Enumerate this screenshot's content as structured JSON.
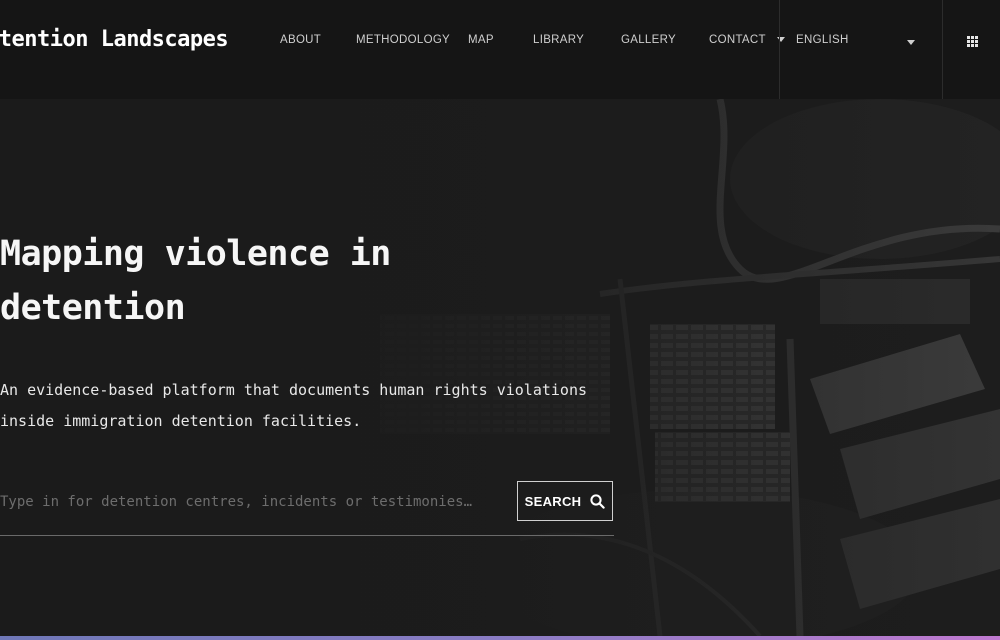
{
  "header": {
    "brand": "etention Landscapes",
    "nav": [
      {
        "label": "ABOUT"
      },
      {
        "label": "METHODOLOGY"
      },
      {
        "label": "MAP"
      },
      {
        "label": "LIBRARY"
      },
      {
        "label": "GALLERY"
      },
      {
        "label": "CONTACT"
      }
    ],
    "language": "ENGLISH",
    "menu_icon": "grid-icon"
  },
  "hero": {
    "title": "Mapping violence in detention",
    "subtitle": "An evidence-based platform that documents human rights violations inside immigration detention facilities.",
    "search_placeholder": "Type in for detention centres, incidents or testimonies…",
    "search_button": "SEARCH",
    "search_icon": "search-icon"
  }
}
